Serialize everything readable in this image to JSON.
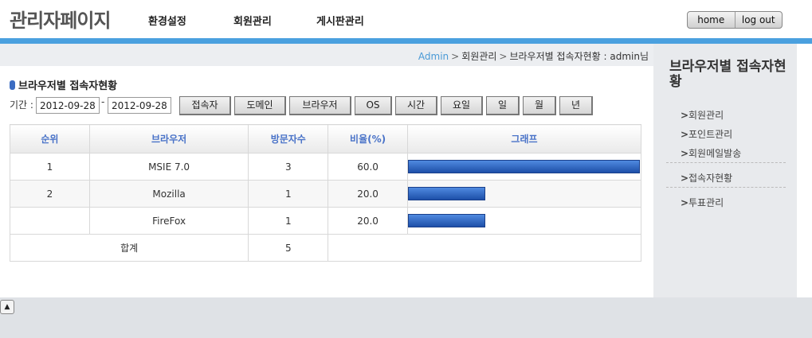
{
  "header": {
    "logo": "관리자페이지",
    "nav": [
      "환경설정",
      "회원관리",
      "게시판관리"
    ],
    "buttons": [
      "home",
      "log out"
    ]
  },
  "breadcrumb": {
    "root": "Admin",
    "sep": ">",
    "level1": "회원관리",
    "level2": "브라우저별 접속자현황 : admin님"
  },
  "page": {
    "title": "브라우저별 접속자현황",
    "period_label": "기간 :",
    "date_from": "2012-09-28",
    "date_sep": "-",
    "date_to": "2012-09-28",
    "filters": [
      "접속자",
      "도메인",
      "브라우저",
      "OS",
      "시간",
      "요일",
      "일",
      "월",
      "년"
    ]
  },
  "table": {
    "headers": [
      "순위",
      "브라우저",
      "방문자수",
      "비율(%)",
      "그래프"
    ],
    "rows": [
      {
        "rank": "1",
        "browser": "MSIE 7.0",
        "visitors": "3",
        "ratio": "60.0",
        "bar_fraction": 1.0
      },
      {
        "rank": "2",
        "browser": "Mozilla",
        "visitors": "1",
        "ratio": "20.0",
        "bar_fraction": 0.333
      },
      {
        "rank": "",
        "browser": "FireFox",
        "visitors": "1",
        "ratio": "20.0",
        "bar_fraction": 0.333
      }
    ],
    "total_label": "합계",
    "total_value": "5"
  },
  "sidebar": {
    "title": "브라우저별 접속자현황",
    "chevron": ">",
    "items": [
      "회원관리",
      "포인트관리",
      "회원메일발송",
      "접속자현황",
      "투표관리"
    ]
  },
  "footer": {
    "up_icon": "▲"
  },
  "colors": {
    "accent": "#4aa0df",
    "header_text": "#4a73c8",
    "bar": "#2f65c4"
  }
}
